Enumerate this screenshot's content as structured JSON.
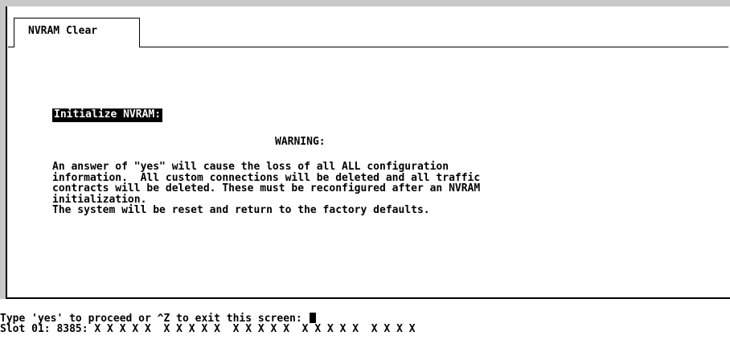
{
  "tab": {
    "label": "NVRAM Clear"
  },
  "section": {
    "heading": "Initialize NVRAM:"
  },
  "warning": {
    "title": "WARNING:",
    "lines": [
      "An answer of \"yes\" will cause the loss of all ALL configuration",
      "information.  All custom connections will be deleted and all traffic",
      "contracts will be deleted. These must be reconfigured after an NVRAM",
      "initialization.",
      "The system will be reset and return to the factory defaults."
    ]
  },
  "prompt": {
    "text": "Type 'yes' to proceed or ^Z to exit this screen: "
  },
  "status": {
    "text": "Slot 01: 8385: X X X X X  X X X X X  X X X X X  X X X X X  X X X X"
  },
  "colors": {
    "background": "#ffffff",
    "foreground": "#000000",
    "frame": "#c8c8c8"
  }
}
